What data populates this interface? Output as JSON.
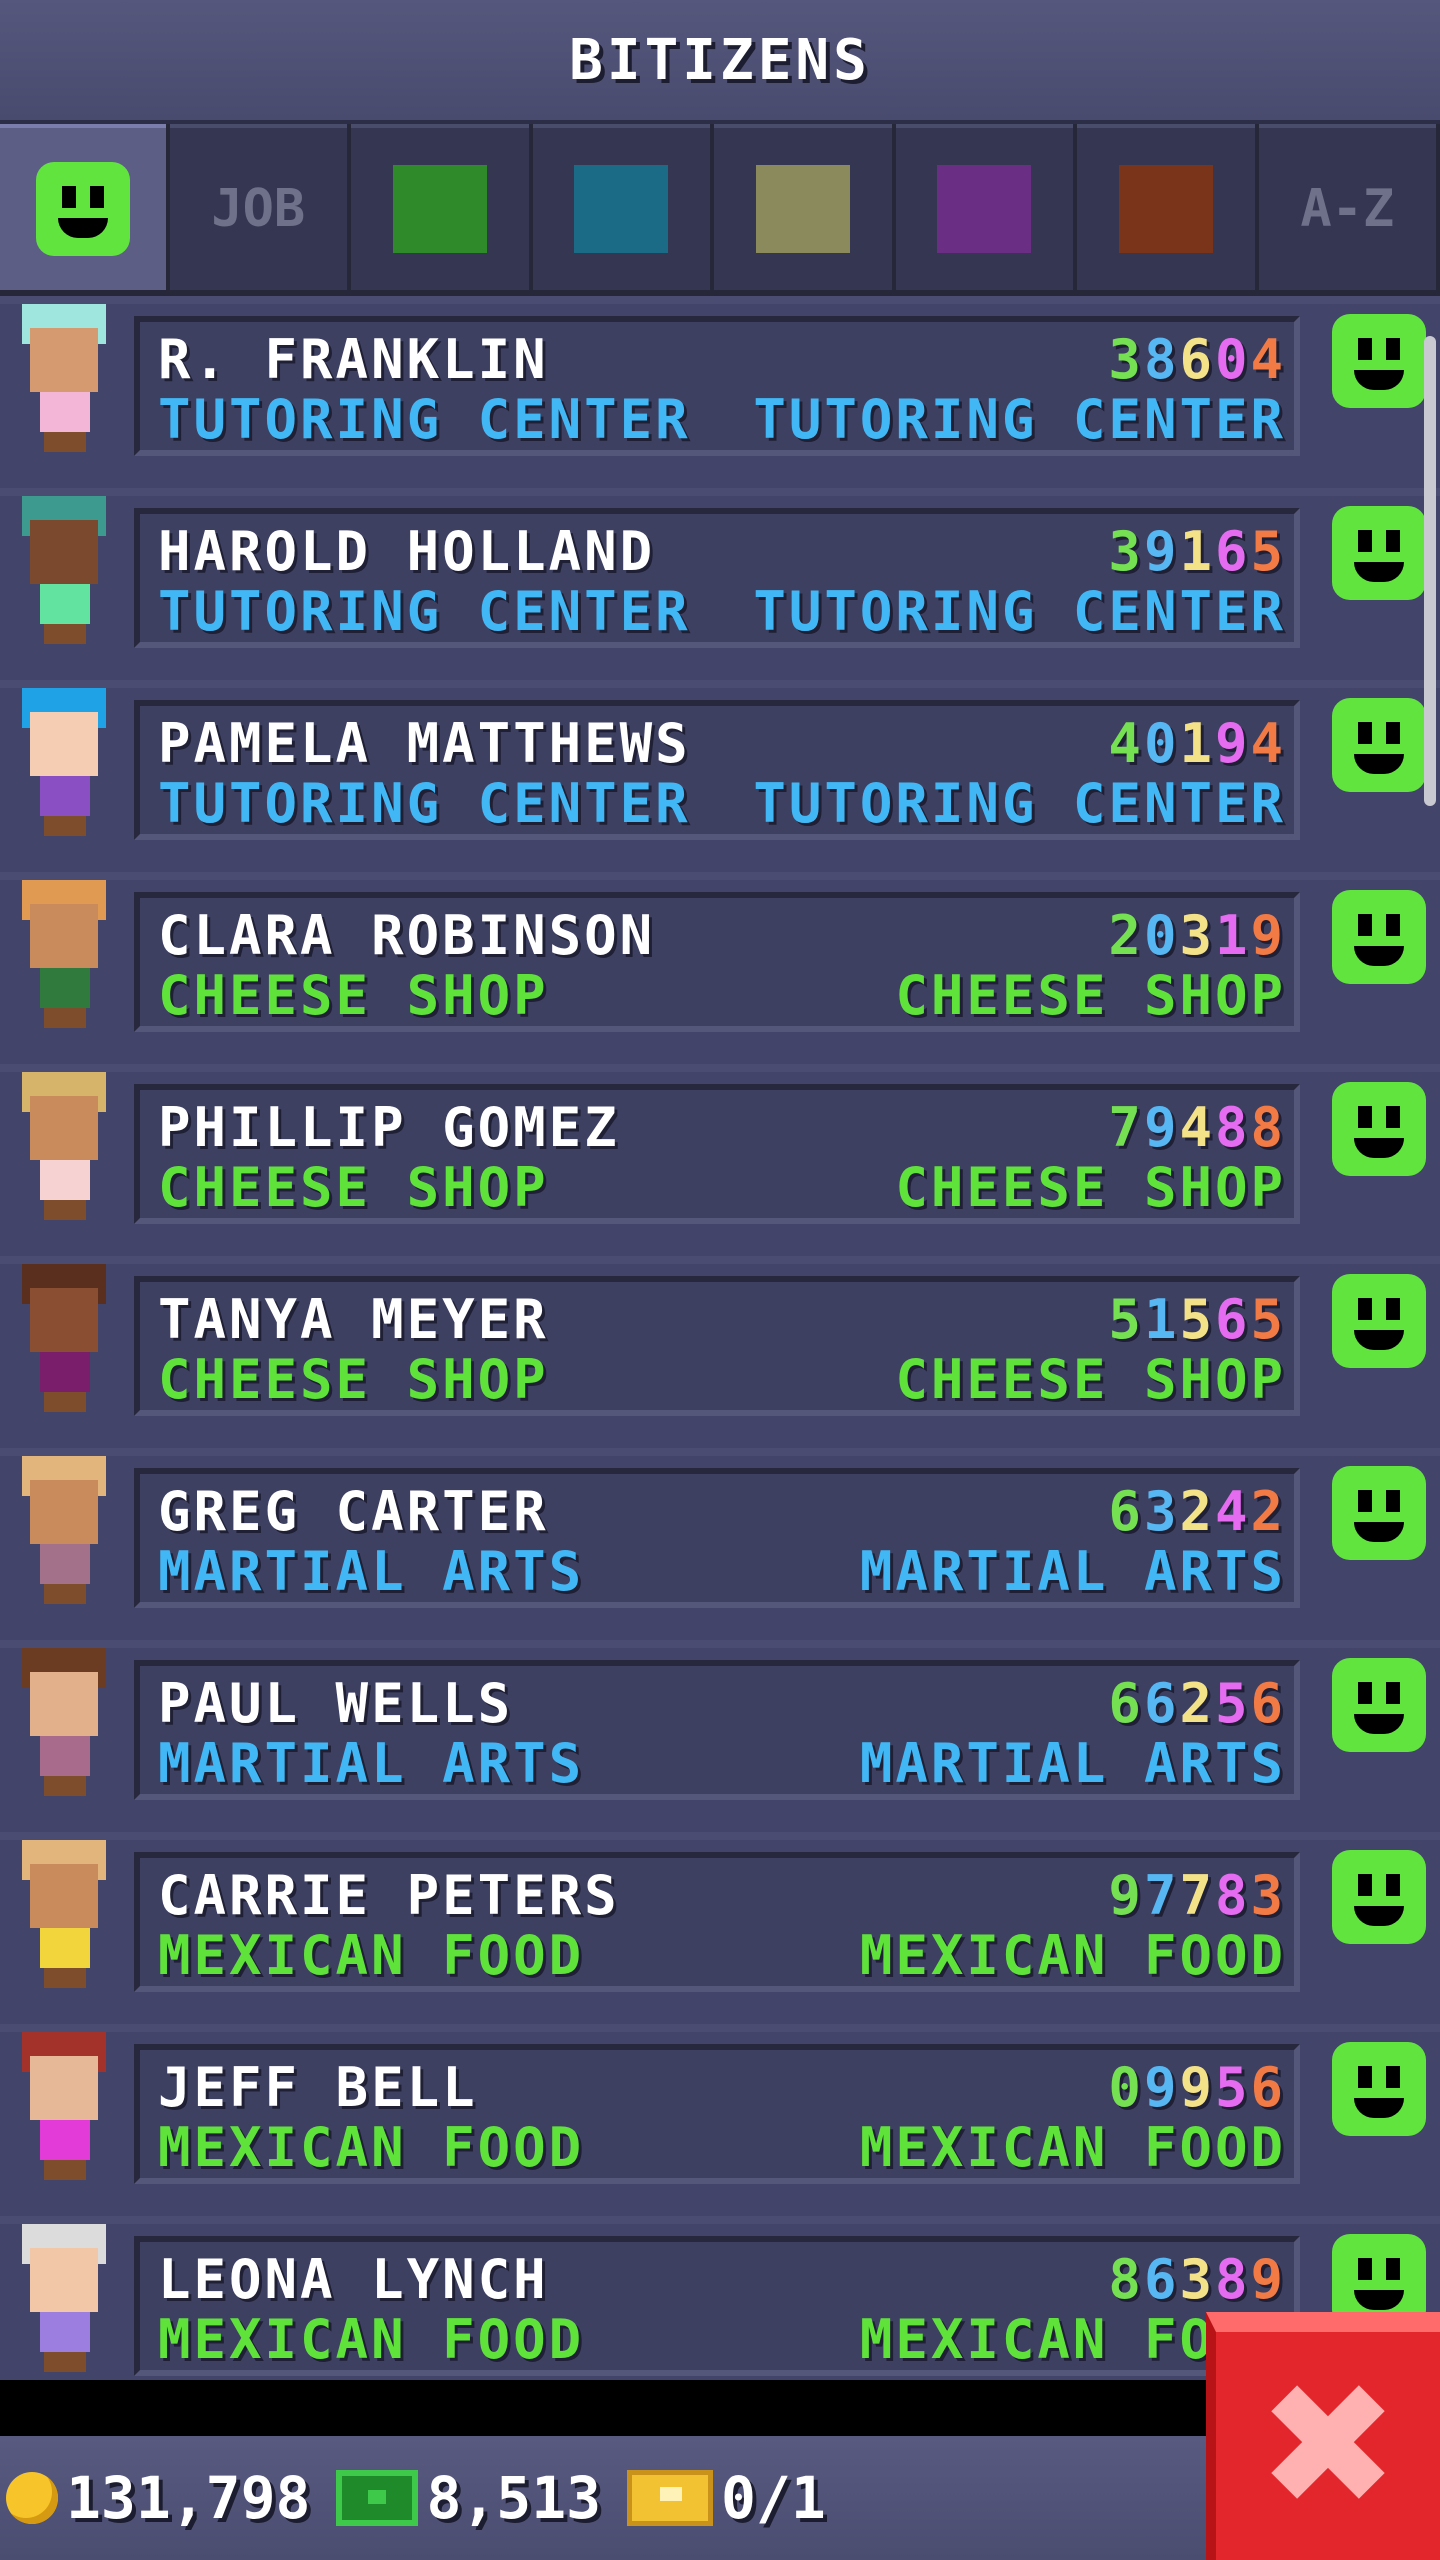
{
  "header": {
    "title": "BITIZENS"
  },
  "tabs": [
    {
      "type": "face",
      "active": true
    },
    {
      "label": "JOB"
    },
    {
      "swatch": "#2f8a2a"
    },
    {
      "swatch": "#1b6b87"
    },
    {
      "swatch": "#8a8a5c"
    },
    {
      "swatch": "#6a2e84"
    },
    {
      "swatch": "#7a3419"
    },
    {
      "label": "A-Z"
    }
  ],
  "bitizens": [
    {
      "name": "R. FRANKLIN",
      "digits": [
        "3",
        "8",
        "6",
        "0",
        "4"
      ],
      "job": "TUTORING CENTER",
      "building": "TUTORING CENTER",
      "job_color": "#41b8f5",
      "hair": "#9fe6df",
      "skin": "#d59a6f",
      "shirt": "#f4b6d6"
    },
    {
      "name": "HAROLD HOLLAND",
      "digits": [
        "3",
        "9",
        "1",
        "6",
        "5"
      ],
      "job": "TUTORING CENTER",
      "building": "TUTORING CENTER",
      "job_color": "#41b8f5",
      "hair": "#3c9b8e",
      "skin": "#7b4a2e",
      "shirt": "#62e39f"
    },
    {
      "name": "PAMELA MATTHEWS",
      "digits": [
        "4",
        "0",
        "1",
        "9",
        "4"
      ],
      "job": "TUTORING CENTER",
      "building": "TUTORING CENTER",
      "job_color": "#41b8f5",
      "hair": "#1fa3e6",
      "skin": "#f5cdb3",
      "shirt": "#8a4fc2"
    },
    {
      "name": "CLARA ROBINSON",
      "digits": [
        "2",
        "0",
        "3",
        "1",
        "9"
      ],
      "job": "CHEESE SHOP",
      "building": "CHEESE SHOP",
      "job_color": "#5fe33a",
      "hair": "#e19a52",
      "skin": "#c98a5c",
      "shirt": "#2f7a3c"
    },
    {
      "name": "PHILLIP GOMEZ",
      "digits": [
        "7",
        "9",
        "4",
        "8",
        "8"
      ],
      "job": "CHEESE SHOP",
      "building": "CHEESE SHOP",
      "job_color": "#5fe33a",
      "hair": "#d6b56a",
      "skin": "#c98a5c",
      "shirt": "#f6d2d2"
    },
    {
      "name": "TANYA MEYER",
      "digits": [
        "5",
        "1",
        "5",
        "6",
        "5"
      ],
      "job": "CHEESE SHOP",
      "building": "CHEESE SHOP",
      "job_color": "#5fe33a",
      "hair": "#5b2f1e",
      "skin": "#8a4e32",
      "shirt": "#7a1d6a"
    },
    {
      "name": "GREG CARTER",
      "digits": [
        "6",
        "3",
        "2",
        "4",
        "2"
      ],
      "job": "MARTIAL ARTS",
      "building": "MARTIAL ARTS",
      "job_color": "#41b8f5",
      "hair": "#e1b57c",
      "skin": "#c98a5c",
      "shirt": "#a3728a"
    },
    {
      "name": "PAUL WELLS",
      "digits": [
        "6",
        "6",
        "2",
        "5",
        "6"
      ],
      "job": "MARTIAL ARTS",
      "building": "MARTIAL ARTS",
      "job_color": "#41b8f5",
      "hair": "#6b3b22",
      "skin": "#e2b08a",
      "shirt": "#a96b8c"
    },
    {
      "name": "CARRIE PETERS",
      "digits": [
        "9",
        "7",
        "7",
        "8",
        "3"
      ],
      "job": "MEXICAN FOOD",
      "building": "MEXICAN FOOD",
      "job_color": "#5fe33a",
      "hair": "#e1b57c",
      "skin": "#c98a5c",
      "shirt": "#f2d43c"
    },
    {
      "name": "JEFF BELL",
      "digits": [
        "0",
        "9",
        "9",
        "5",
        "6"
      ],
      "job": "MEXICAN FOOD",
      "building": "MEXICAN FOOD",
      "job_color": "#5fe33a",
      "hair": "#a3322b",
      "skin": "#e6b897",
      "shirt": "#e23bd8"
    },
    {
      "name": "LEONA LYNCH",
      "digits": [
        "8",
        "6",
        "3",
        "8",
        "9"
      ],
      "job": "MEXICAN FOOD",
      "building": "MEXICAN FOOD",
      "job_color": "#5fe33a",
      "hair": "#dcdcdc",
      "skin": "#f2c7a8",
      "shirt": "#9b7ee0"
    }
  ],
  "bottom": {
    "coins": "131,798",
    "bux": "8,513",
    "tickets": "0/1"
  },
  "close": {
    "symbol": "✖"
  }
}
